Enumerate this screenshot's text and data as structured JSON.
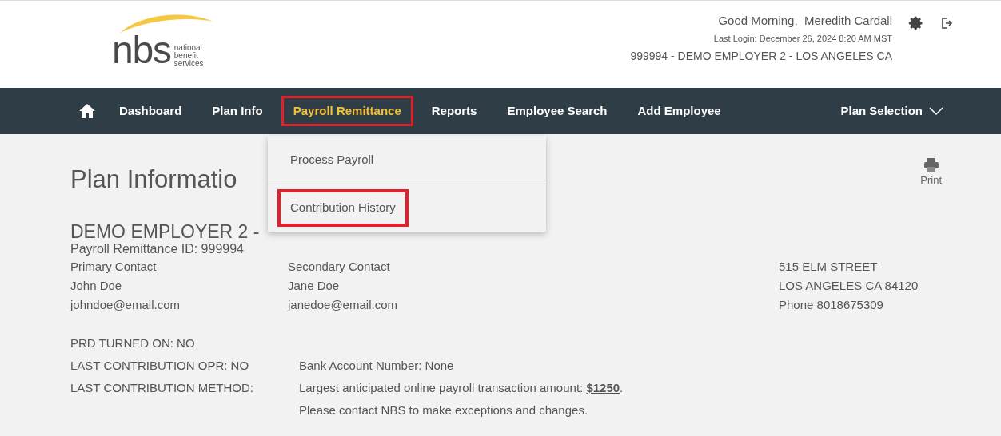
{
  "logo": {
    "wordmark": "nbs",
    "tagline": [
      "national",
      "benefit",
      "services"
    ]
  },
  "header": {
    "greeting": "Good Morning,  Meredith Cardall",
    "last_login": "Last Login: December 26, 2024 8:20 AM MST",
    "employer": "999994 - DEMO EMPLOYER 2 - LOS ANGELES CA"
  },
  "nav": {
    "items": [
      {
        "label": "Dashboard",
        "selected": false,
        "highlighted": false
      },
      {
        "label": "Plan Info",
        "selected": false,
        "highlighted": false
      },
      {
        "label": "Payroll Remittance",
        "selected": true,
        "highlighted": true
      },
      {
        "label": "Reports",
        "selected": false,
        "highlighted": false
      },
      {
        "label": "Employee Search",
        "selected": false,
        "highlighted": false
      },
      {
        "label": "Add Employee",
        "selected": false,
        "highlighted": false
      }
    ],
    "plan_selection": "Plan Selection"
  },
  "dropdown": {
    "items": [
      {
        "label": "Process Payroll",
        "highlighted": false
      },
      {
        "label": "Contribution History",
        "highlighted": true
      }
    ]
  },
  "page": {
    "title": "Plan Informatio",
    "print": "Print",
    "employer_heading": "DEMO EMPLOYER 2 -",
    "remittance_id": "Payroll Remittance ID: 999994",
    "primary": {
      "heading": "Primary Contact",
      "name": "John Doe",
      "email": "johndoe@email.com"
    },
    "secondary": {
      "heading": "Secondary Contact",
      "name": "Jane Doe",
      "email": "janedoe@email.com"
    },
    "address": [
      "515 ELM STREET",
      "LOS ANGELES CA 84120",
      "Phone 8018675309"
    ],
    "status": [
      {
        "label": "PRD TURNED ON: NO"
      },
      {
        "label": "LAST CONTRIBUTION OPR: NO",
        "value": "Bank Account Number: None"
      },
      {
        "label": "LAST CONTRIBUTION METHOD:",
        "value": "Largest anticipated online payroll transaction amount: **$1250**."
      }
    ],
    "note": "Please contact NBS to make exceptions and changes."
  }
}
